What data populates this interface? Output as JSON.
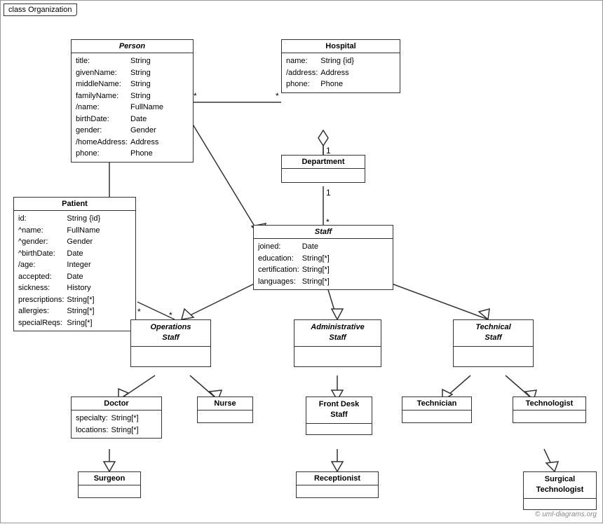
{
  "diagram": {
    "title": "class Organization",
    "watermark": "© uml-diagrams.org",
    "classes": {
      "person": {
        "name": "Person",
        "italic": true,
        "fields": [
          [
            "title:",
            "String"
          ],
          [
            "givenName:",
            "String"
          ],
          [
            "middleName:",
            "String"
          ],
          [
            "familyName:",
            "String"
          ],
          [
            "/name:",
            "FullName"
          ],
          [
            "birthDate:",
            "Date"
          ],
          [
            "gender:",
            "Gender"
          ],
          [
            "/homeAddress:",
            "Address"
          ],
          [
            "phone:",
            "Phone"
          ]
        ]
      },
      "hospital": {
        "name": "Hospital",
        "italic": false,
        "fields": [
          [
            "name:",
            "String {id}"
          ],
          [
            "/address:",
            "Address"
          ],
          [
            "phone:",
            "Phone"
          ]
        ]
      },
      "patient": {
        "name": "Patient",
        "italic": false,
        "fields": [
          [
            "id:",
            "String {id}"
          ],
          [
            "^name:",
            "FullName"
          ],
          [
            "^gender:",
            "Gender"
          ],
          [
            "^birthDate:",
            "Date"
          ],
          [
            "/age:",
            "Integer"
          ],
          [
            "accepted:",
            "Date"
          ],
          [
            "sickness:",
            "History"
          ],
          [
            "prescriptions:",
            "String[*]"
          ],
          [
            "allergies:",
            "String[*]"
          ],
          [
            "specialReqs:",
            "Sring[*]"
          ]
        ]
      },
      "department": {
        "name": "Department",
        "italic": false,
        "fields": []
      },
      "staff": {
        "name": "Staff",
        "italic": true,
        "fields": [
          [
            "joined:",
            "Date"
          ],
          [
            "education:",
            "String[*]"
          ],
          [
            "certification:",
            "String[*]"
          ],
          [
            "languages:",
            "String[*]"
          ]
        ]
      },
      "operations_staff": {
        "name": "Operations\nStaff",
        "italic": true,
        "fields": []
      },
      "administrative_staff": {
        "name": "Administrative\nStaff",
        "italic": true,
        "fields": []
      },
      "technical_staff": {
        "name": "Technical\nStaff",
        "italic": true,
        "fields": []
      },
      "doctor": {
        "name": "Doctor",
        "italic": false,
        "fields": [
          [
            "specialty:",
            "String[*]"
          ],
          [
            "locations:",
            "String[*]"
          ]
        ]
      },
      "nurse": {
        "name": "Nurse",
        "italic": false,
        "fields": []
      },
      "front_desk_staff": {
        "name": "Front Desk\nStaff",
        "italic": false,
        "fields": []
      },
      "technician": {
        "name": "Technician",
        "italic": false,
        "fields": []
      },
      "technologist": {
        "name": "Technologist",
        "italic": false,
        "fields": []
      },
      "surgeon": {
        "name": "Surgeon",
        "italic": false,
        "fields": []
      },
      "receptionist": {
        "name": "Receptionist",
        "italic": false,
        "fields": []
      },
      "surgical_technologist": {
        "name": "Surgical\nTechnologist",
        "italic": false,
        "fields": []
      }
    }
  }
}
